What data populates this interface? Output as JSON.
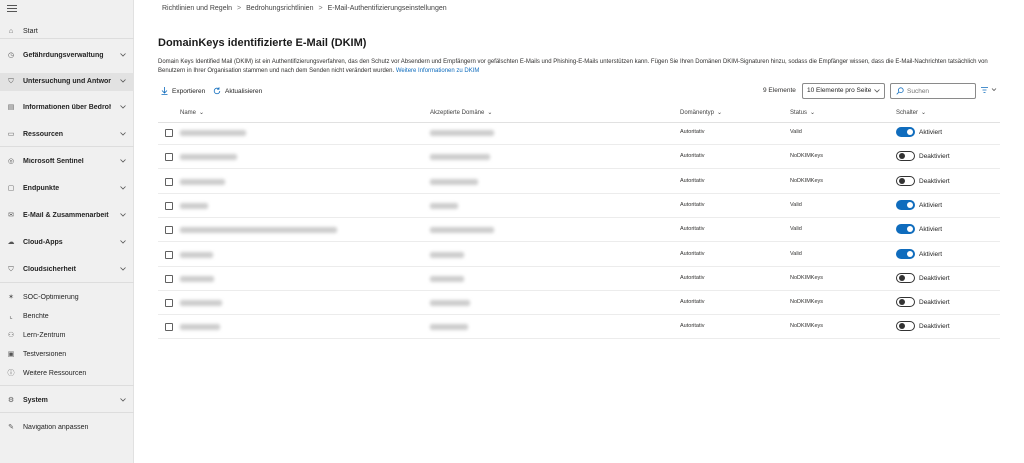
{
  "sidebar": {
    "items": [
      {
        "label": "Start",
        "icon": "home-icon",
        "bold": false,
        "chevron": false,
        "active": false
      },
      {
        "label": "Gefährdungsverwaltung",
        "icon": "shield-clock-icon",
        "bold": true,
        "chevron": true,
        "active": false
      },
      {
        "label": "Untersuchung und Antwort",
        "icon": "shield-alert-icon",
        "bold": true,
        "chevron": true,
        "active": true
      },
      {
        "label": "Informationen über Bedrohu",
        "icon": "intel-icon",
        "bold": true,
        "chevron": true,
        "active": false
      },
      {
        "label": "Ressourcen",
        "icon": "assets-icon",
        "bold": true,
        "chevron": true,
        "active": false
      },
      {
        "label": "Microsoft Sentinel",
        "icon": "sentinel-icon",
        "bold": true,
        "chevron": true,
        "active": false
      },
      {
        "label": "Endpunkte",
        "icon": "endpoint-icon",
        "bold": true,
        "chevron": true,
        "active": false
      },
      {
        "label": "E-Mail & Zusammenarbeit",
        "icon": "mail-icon",
        "bold": true,
        "chevron": true,
        "active": false
      },
      {
        "label": "Cloud-Apps",
        "icon": "cloud-icon",
        "bold": true,
        "chevron": true,
        "active": false
      },
      {
        "label": "Cloudsicherheit",
        "icon": "cloud-shield-icon",
        "bold": true,
        "chevron": true,
        "active": false
      },
      {
        "label": "SOC-Optimierung",
        "icon": "optimize-icon",
        "bold": false,
        "chevron": false,
        "active": false
      },
      {
        "label": "Berichte",
        "icon": "chart-icon",
        "bold": false,
        "chevron": false,
        "active": false
      },
      {
        "label": "Lern-Zentrum",
        "icon": "learn-icon",
        "bold": false,
        "chevron": false,
        "active": false
      },
      {
        "label": "Testversionen",
        "icon": "gift-icon",
        "bold": false,
        "chevron": false,
        "active": false
      },
      {
        "label": "Weitere Ressourcen",
        "icon": "info-icon",
        "bold": false,
        "chevron": false,
        "active": false
      },
      {
        "label": "System",
        "icon": "gear-icon",
        "bold": true,
        "chevron": true,
        "active": false
      },
      {
        "label": "Navigation anpassen",
        "icon": "pencil-icon",
        "bold": false,
        "chevron": false,
        "active": false
      }
    ]
  },
  "breadcrumb": [
    "Richtlinien und Regeln",
    "Bedrohungsrichtlinien",
    "E-Mail-Authentifizierungseinstellungen"
  ],
  "page": {
    "title": "DomainKeys identifizierte E-Mail (DKIM)",
    "description": "Domain Keys Identified Mail (DKIM) ist ein Authentifizierungsverfahren, das den Schutz vor Absendern und Empfängern vor gefälschten E-Mails und Phishing-E-Mails unterstützen kann. Fügen Sie Ihren Domänen DKIM-Signaturen hinzu, sodass die Empfänger wissen, dass die E-Mail-Nachrichten tatsächlich von Benutzern in Ihrer Organisation stammen und nach dem Senden nicht verändert wurden.",
    "link": "Weitere Informationen zu DKIM"
  },
  "toolbar": {
    "export_label": "Exportieren",
    "refresh_label": "Aktualisieren",
    "count": "9 Elemente",
    "per_page": "10 Elemente pro Seite",
    "search_placeholder": "Suchen"
  },
  "table": {
    "headers": {
      "name": "Name",
      "domain": "Akzeptierte Domäne",
      "type": "Domänentyp",
      "status": "Status",
      "toggle": "Schalter"
    },
    "rows": [
      {
        "type": "Autoritativ",
        "status": "Valid",
        "on": true,
        "toggle_label": "Aktiviert"
      },
      {
        "type": "Autoritativ",
        "status": "NoDKIMKeys",
        "on": false,
        "toggle_label": "Deaktiviert"
      },
      {
        "type": "Autoritativ",
        "status": "NoDKIMKeys",
        "on": false,
        "toggle_label": "Deaktiviert"
      },
      {
        "type": "Autoritativ",
        "status": "Valid",
        "on": true,
        "toggle_label": "Aktiviert"
      },
      {
        "type": "Autoritativ",
        "status": "Valid",
        "on": true,
        "toggle_label": "Aktiviert"
      },
      {
        "type": "Autoritativ",
        "status": "Valid",
        "on": true,
        "toggle_label": "Aktiviert"
      },
      {
        "type": "Autoritativ",
        "status": "NoDKIMKeys",
        "on": false,
        "toggle_label": "Deaktiviert"
      },
      {
        "type": "Autoritativ",
        "status": "NoDKIMKeys",
        "on": false,
        "toggle_label": "Deaktiviert"
      },
      {
        "type": "Autoritativ",
        "status": "NoDKIMKeys",
        "on": false,
        "toggle_label": "Deaktiviert"
      }
    ]
  },
  "colors": {
    "accent": "#0f6cbd",
    "sidebar_bg": "#f0f0f0"
  }
}
